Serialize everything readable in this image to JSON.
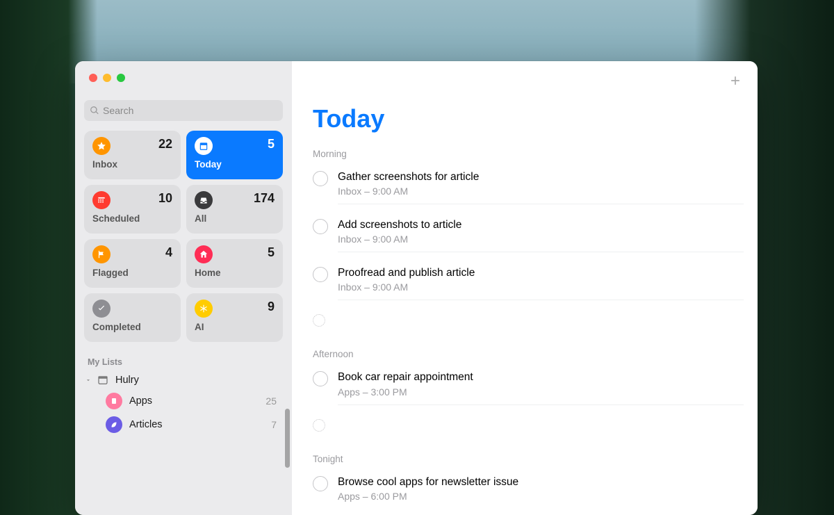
{
  "search": {
    "placeholder": "Search"
  },
  "cards": [
    {
      "id": "inbox",
      "label": "Inbox",
      "count": "22",
      "iconColor": "#ff9500",
      "icon": "star"
    },
    {
      "id": "today",
      "label": "Today",
      "count": "5",
      "iconColor": "#fff",
      "icon": "calendar",
      "selected": true
    },
    {
      "id": "scheduled",
      "label": "Scheduled",
      "count": "10",
      "iconColor": "#ff3b30",
      "icon": "cal-grid"
    },
    {
      "id": "all",
      "label": "All",
      "count": "174",
      "iconColor": "#3a3a3c",
      "icon": "tray"
    },
    {
      "id": "flagged",
      "label": "Flagged",
      "count": "4",
      "iconColor": "#ff9500",
      "icon": "flag"
    },
    {
      "id": "home",
      "label": "Home",
      "count": "5",
      "iconColor": "#ff2d55",
      "icon": "house"
    },
    {
      "id": "completed",
      "label": "Completed",
      "count": "",
      "iconColor": "#8e8e93",
      "icon": "check"
    },
    {
      "id": "ai",
      "label": "AI",
      "count": "9",
      "iconColor": "#ffcc00",
      "icon": "asterisk"
    }
  ],
  "mylists": {
    "header": "My Lists",
    "folder": "Hulry",
    "items": [
      {
        "id": "apps",
        "label": "Apps",
        "count": "25",
        "color": "#ff7aa0",
        "icon": "app"
      },
      {
        "id": "articles",
        "label": "Articles",
        "count": "7",
        "color": "#6b5ce5",
        "icon": "leaf"
      }
    ]
  },
  "main": {
    "title": "Today",
    "sections": [
      {
        "label": "Morning",
        "tasks": [
          {
            "title": "Gather screenshots for article",
            "sub": "Inbox – 9:00 AM"
          },
          {
            "title": "Add screenshots to article",
            "sub": "Inbox – 9:00 AM"
          },
          {
            "title": "Proofread and publish article",
            "sub": "Inbox – 9:00 AM"
          },
          {
            "empty": true
          }
        ]
      },
      {
        "label": "Afternoon",
        "tasks": [
          {
            "title": "Book car repair appointment",
            "sub": "Apps – 3:00 PM"
          },
          {
            "empty": true
          }
        ]
      },
      {
        "label": "Tonight",
        "tasks": [
          {
            "title": "Browse cool apps for newsletter issue",
            "sub": "Apps – 6:00 PM"
          }
        ]
      }
    ]
  }
}
